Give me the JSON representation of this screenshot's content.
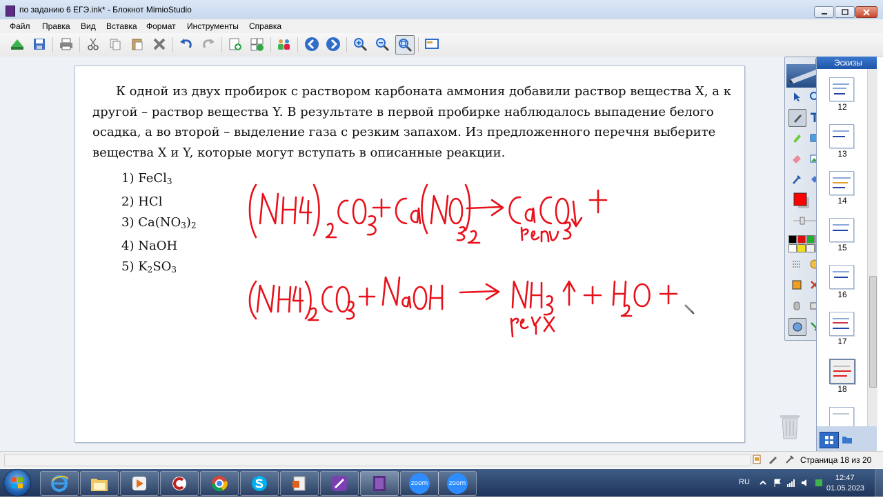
{
  "window": {
    "title": "по заданию 6 ЕГЭ.ink* - Блокнот MimioStudio"
  },
  "menu": [
    "Файл",
    "Правка",
    "Вид",
    "Вставка",
    "Формат",
    "Инструменты",
    "Справка"
  ],
  "toolbar_icons": [
    "open-icon",
    "save-icon",
    "print-icon",
    "cut-icon",
    "copy-icon",
    "paste-icon",
    "delete-icon",
    "undo-icon",
    "redo-icon",
    "new-page-icon",
    "insert-page-icon",
    "users-icon",
    "previous-page-icon",
    "next-page-icon",
    "zoom-in-icon",
    "zoom-out-icon",
    "zoom-fit-icon",
    "screen-icon"
  ],
  "document": {
    "task": "К одной из двух пробирок с раствором карбоната аммония добавили раствор вещества X, а к другой – раствор вещества Y. В результате в первой пробирке наблюдалось выпадение белого осадка, а во второй – выделение газа с резким запахом. Из предложенного перечня выберите вещества X и Y, которые могут вступать в описанные реакции.",
    "options": [
      {
        "num": "1)",
        "parts": [
          "FeCl",
          "3",
          ""
        ]
      },
      {
        "num": "2)",
        "parts": [
          "HCl",
          "",
          ""
        ]
      },
      {
        "num": "3)",
        "parts": [
          "Ca(NO",
          "3",
          ")",
          "2"
        ]
      },
      {
        "num": "4)",
        "parts": [
          "NaOH",
          "",
          ""
        ]
      },
      {
        "num": "5)",
        "parts": [
          "K",
          "2",
          "SO",
          "3"
        ]
      }
    ],
    "ink_color": "#e8101a"
  },
  "sidebar": {
    "tab_label": "Эскизы",
    "thumbnails": [
      "12",
      "13",
      "14",
      "15",
      "16",
      "17",
      "18"
    ],
    "active": "18"
  },
  "status": {
    "page_text": "Страница 18 из 20"
  },
  "tray": {
    "lang": "RU",
    "time": "12:47",
    "date": "01.05.2023"
  },
  "taskbar": {
    "zoom_label": "zoom"
  },
  "colors": {
    "accent": "#2d6fcf",
    "ink": "#e8101a"
  }
}
